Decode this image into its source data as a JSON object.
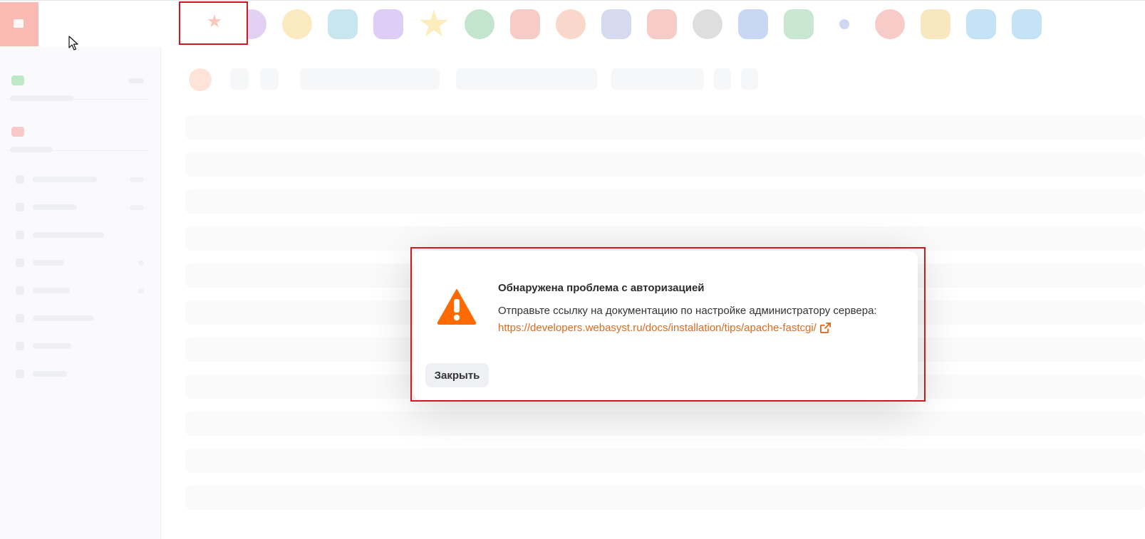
{
  "topbar": {
    "apps": [
      {
        "icon": "shop-icon",
        "color": "#33b98a",
        "shape": "rounded"
      },
      {
        "icon": "chart-icon",
        "color": "#9a5ad6",
        "shape": "round"
      },
      {
        "icon": "photos-icon",
        "color": "#f0b21d",
        "shape": "round"
      },
      {
        "icon": "contacts-icon",
        "color": "#3aa6c9",
        "shape": "rounded"
      },
      {
        "icon": "mail-icon",
        "color": "#8a4de0",
        "shape": "rounded"
      },
      {
        "icon": "favorites-icon",
        "color": "#f4c20d",
        "shape": "star"
      },
      {
        "icon": "hub-icon",
        "color": "#2aa34a",
        "shape": "round"
      },
      {
        "icon": "files-icon",
        "color": "#e0443a",
        "shape": "rounded"
      },
      {
        "icon": "team-icon",
        "color": "#e8713f",
        "shape": "round"
      },
      {
        "icon": "calendar-icon",
        "color": "#6a7acb",
        "shape": "rounded"
      },
      {
        "icon": "magic-icon",
        "color": "#e0443a",
        "shape": "rounded"
      },
      {
        "icon": "clock-icon",
        "color": "#888888",
        "shape": "round"
      },
      {
        "icon": "rocket-icon",
        "color": "#3f6fd8",
        "shape": "rounded"
      },
      {
        "icon": "lock-icon",
        "color": "#3aa655",
        "shape": "rounded"
      },
      {
        "icon": "dot-icon",
        "color": "#4a6ed8",
        "shape": "small"
      },
      {
        "icon": "target-icon",
        "color": "#e0443a",
        "shape": "round"
      },
      {
        "icon": "apps-icon",
        "color": "#e8a81d",
        "shape": "rounded"
      },
      {
        "icon": "folder-icon",
        "color": "#2f9be0",
        "shape": "rounded"
      },
      {
        "icon": "chat-icon",
        "color": "#2f9be0",
        "shape": "rounded"
      }
    ]
  },
  "dialog": {
    "title": "Обнаружена проблема с авторизацией",
    "message": "Отправьте ссылку на документацию по настройке администратору сервера:",
    "link_text": "https://developers.webasyst.ru/docs/installation/tips/apache-fastcgi/",
    "close_label": "Закрыть",
    "warning_color": "#ff6a00",
    "link_color": "#e06a1b"
  }
}
